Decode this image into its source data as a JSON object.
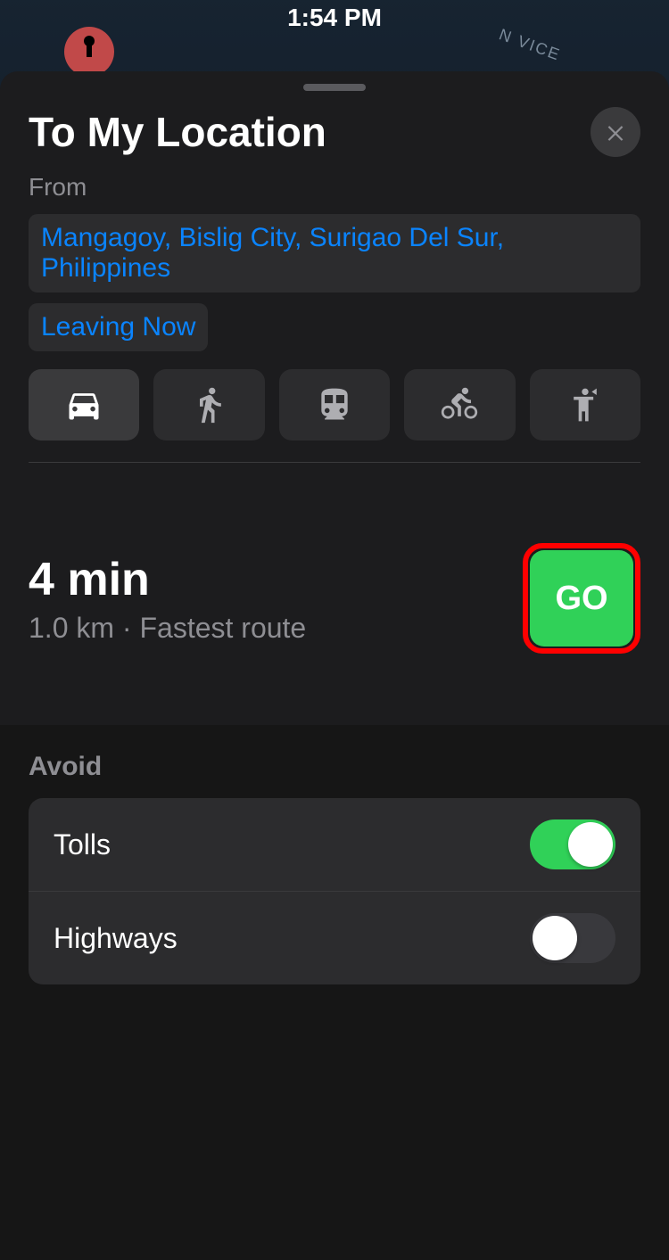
{
  "status": {
    "time": "1:54 PM"
  },
  "header": {
    "title": "To My Location"
  },
  "from": {
    "label": "From",
    "location": "Mangagoy, Bislig City, Surigao Del Sur, Philippines",
    "departure": "Leaving Now"
  },
  "modes": {
    "items": [
      "drive",
      "walk",
      "transit",
      "cycle",
      "rideshare"
    ],
    "active": 0
  },
  "route": {
    "duration": "4 min",
    "distance": "1.0 km",
    "separator": " · ",
    "note": "Fastest route",
    "go_label": "GO"
  },
  "avoid": {
    "title": "Avoid",
    "options": [
      {
        "label": "Tolls",
        "on": true
      },
      {
        "label": "Highways",
        "on": false
      }
    ]
  },
  "map": {
    "road_label": "N VICE"
  }
}
